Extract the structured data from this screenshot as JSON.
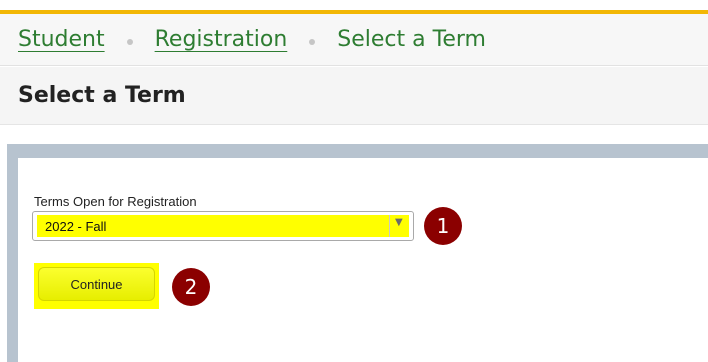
{
  "breadcrumb": {
    "items": [
      {
        "label": "Student",
        "is_link": true
      },
      {
        "label": "Registration",
        "is_link": true
      },
      {
        "label": "Select a Term",
        "is_link": false
      }
    ]
  },
  "page": {
    "title": "Select a Term"
  },
  "form": {
    "term_label": "Terms Open for Registration",
    "term_selected": "2022 - Fall",
    "continue_label": "Continue"
  },
  "annotations": {
    "step1": "1",
    "step2": "2"
  },
  "colors": {
    "accent": "#f2b705",
    "link": "#2e7d32",
    "highlight": "#ffff00",
    "badge": "#8b0000",
    "frame": "#b7c3cf"
  }
}
